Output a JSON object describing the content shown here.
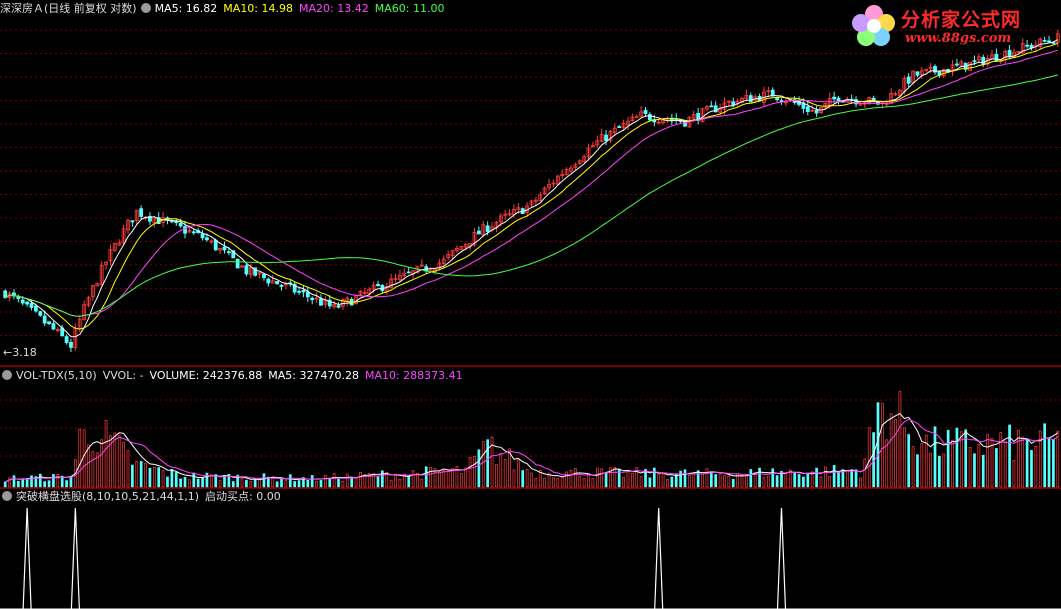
{
  "panels": {
    "main": {
      "title": "深深房Ａ(日线 前复权 对数)",
      "indicators": [
        {
          "label": "MA5: 16.82",
          "color": "#ffffff"
        },
        {
          "label": "MA10: 14.98",
          "color": "#ffff00"
        },
        {
          "label": "MA20: 13.42",
          "color": "#ff44ff"
        },
        {
          "label": "MA60: 11.00",
          "color": "#44ff44"
        }
      ],
      "low_marker": "3.18"
    },
    "volume": {
      "title": "VOL-TDX(5,10)",
      "indicators": [
        {
          "label": "VVOL: -",
          "color": "#dddddd"
        },
        {
          "label": "VOLUME: 242376.88",
          "color": "#ffffff"
        },
        {
          "label": "MA5: 327470.28",
          "color": "#ffffff"
        },
        {
          "label": "MA10: 288373.41",
          "color": "#ff44ff"
        }
      ]
    },
    "signal": {
      "title": "突破横盘选股(8,10,10,5,21,44,1,1)",
      "indicators": [
        {
          "label": "启动买点: 0.00",
          "color": "#dddddd"
        }
      ]
    }
  },
  "logo": {
    "brand": "分析家公式网",
    "url": "www.88gs.com"
  },
  "colors": {
    "up": "#ff3c3c",
    "down": "#54ffff",
    "background": "#000000",
    "ma5": "#ffffff",
    "ma10": "#ffff00",
    "ma20": "#ff44ff",
    "ma60": "#44ff44",
    "grid": "#7a0000",
    "separator": "#a00000"
  },
  "chart_data": [
    {
      "type": "line",
      "name": "price",
      "scale": "log",
      "approx_trend": {
        "x_bar_index": [
          0,
          15,
          20,
          30,
          45,
          55,
          75,
          100,
          110,
          120,
          135,
          145,
          155,
          165,
          175,
          185,
          190,
          200,
          207,
          220,
          240
        ],
        "close": [
          4.5,
          3.3,
          4.6,
          7.2,
          6.2,
          5.1,
          4.1,
          5.4,
          6.6,
          7.5,
          10.8,
          12.6,
          12.2,
          13.6,
          14.3,
          12.8,
          14.1,
          13.5,
          15.9,
          17.0,
          19.8
        ]
      },
      "ma": {
        "MA5": 16.82,
        "MA10": 14.98,
        "MA20": 13.42,
        "MA60": 11.0
      },
      "low_label": 3.18
    },
    {
      "type": "bar",
      "name": "volume",
      "approx_profile": {
        "x_bar_index": [
          0,
          15,
          17,
          20,
          25,
          30,
          40,
          70,
          105,
          110,
          120,
          160,
          195,
          200,
          210,
          240
        ],
        "volume": [
          45000,
          55000,
          260000,
          310000,
          230000,
          120000,
          60000,
          45000,
          90000,
          220000,
          80000,
          70000,
          90000,
          460000,
          230000,
          242376.88
        ]
      },
      "ma": {
        "MA5": 327470.28,
        "MA10": 288373.41
      }
    },
    {
      "type": "line",
      "name": "启动买点",
      "signal_bar_indices": [
        5,
        16,
        149,
        177
      ],
      "value": 0.0
    }
  ]
}
